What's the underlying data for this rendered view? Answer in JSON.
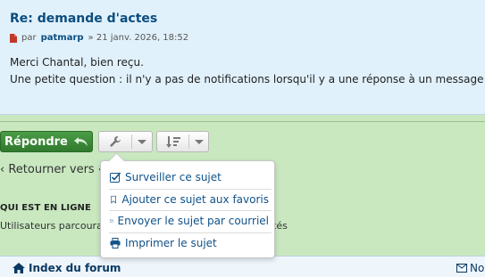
{
  "post": {
    "title": "Re: demande d'actes",
    "by": "par",
    "author": "patmarp",
    "date": "» 21 janv. 2026, 18:52",
    "lines": [
      "Merci Chantal, bien reçu.",
      "Une petite question : il n'y a pas de notifications lorsqu'il y a une réponse à un message ?"
    ]
  },
  "actions": {
    "reply_label": "Répondre",
    "tools_icon": "wrench-icon",
    "sort_icon": "sort-icon"
  },
  "page": {
    "return_link": "‹ Retourner vers ‹",
    "who_online_title": "QUI EST EN LIGNE",
    "who_online_text": "Utilisateurs parcourar",
    "who_online_tail": "tés"
  },
  "tools_menu": {
    "items": [
      {
        "label": "Surveiller ce sujet",
        "icon": "check-square-icon"
      },
      {
        "label": "Ajouter ce sujet aux favoris",
        "icon": "bookmark-icon"
      },
      {
        "label": "Envoyer le sujet par courriel",
        "icon": "envelope-icon"
      },
      {
        "label": "Imprimer le sujet",
        "icon": "print-icon"
      }
    ]
  },
  "footer": {
    "left_label": "Index du forum",
    "right_label": "No"
  },
  "colors": {
    "page_bg": "#c9e8c0",
    "post_bg": "#e1f1fb",
    "link_blue": "#105289",
    "reply_green": "#2f7a2d"
  }
}
